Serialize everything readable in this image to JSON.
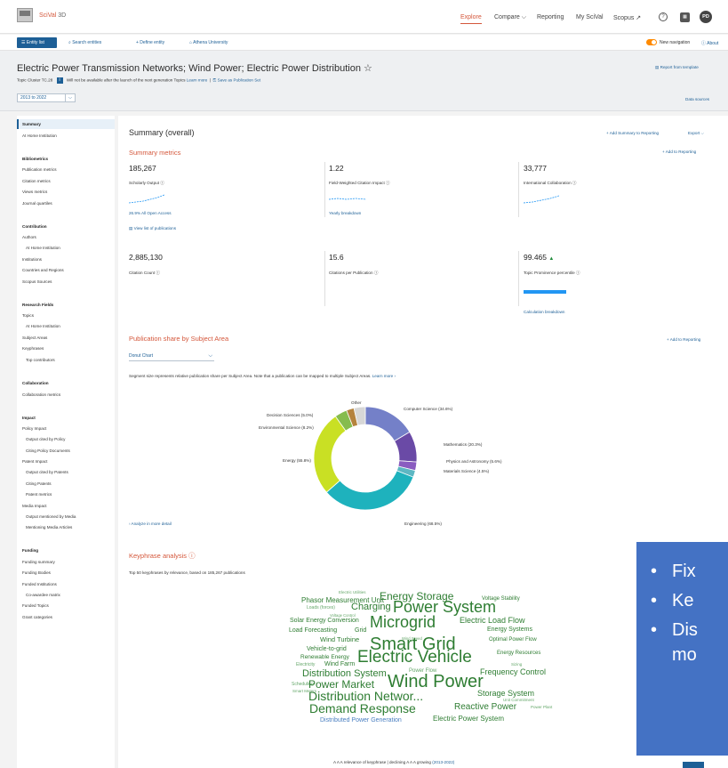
{
  "topbar": {
    "app_name": "SciVal",
    "app_suffix": "3D",
    "nav": [
      "Explore",
      "Compare ⌵",
      "Reporting",
      "My SciVal",
      "Scopus ↗"
    ],
    "help_icon": "?",
    "grid_icon": "▦",
    "avatar": "PD"
  },
  "toolbar": {
    "entity_list": "Entity list",
    "search": "Search entities",
    "define_entity": "+ Define entity",
    "institution": "Athena University",
    "new_navigation": "New navigation",
    "about": "About"
  },
  "title_band": {
    "title": "Electric Power Transmission Networks; Wind Power; Electric Power Distribution",
    "star": "☆",
    "topic_cluster": "Topic Cluster TC.28",
    "notice": "Will not be available after the launch of the next generation Topics",
    "learn_more": "Learn more",
    "save_as": "Save as Publication Set",
    "report": "Report from template",
    "year_range": "2013 to 2022",
    "data_sources": "Data sources"
  },
  "sidebar": {
    "items": [
      {
        "label": "Summary",
        "type": "selected"
      },
      {
        "label": "At Home Institution",
        "type": "item"
      },
      {
        "label": "Bibliometrics",
        "type": "head"
      },
      {
        "label": "Publication metrics",
        "type": "item"
      },
      {
        "label": "Citation metrics",
        "type": "item"
      },
      {
        "label": "Views metrics",
        "type": "item"
      },
      {
        "label": "Journal quartiles",
        "type": "item"
      },
      {
        "label": "Contribution",
        "type": "head"
      },
      {
        "label": "Authors",
        "type": "item"
      },
      {
        "label": "At Home Institution",
        "type": "indent"
      },
      {
        "label": "Institutions",
        "type": "item"
      },
      {
        "label": "Countries and Regions",
        "type": "item"
      },
      {
        "label": "Scopus Sources",
        "type": "item"
      },
      {
        "label": "Research Fields",
        "type": "head"
      },
      {
        "label": "Topics",
        "type": "item"
      },
      {
        "label": "At Home Institution",
        "type": "indent"
      },
      {
        "label": "Subject Areas",
        "type": "item"
      },
      {
        "label": "Keyphrases",
        "type": "item"
      },
      {
        "label": "Top contributors",
        "type": "indent"
      },
      {
        "label": "Collaboration",
        "type": "head"
      },
      {
        "label": "Collaboration metrics",
        "type": "item"
      },
      {
        "label": "Impact",
        "type": "head"
      },
      {
        "label": "Policy Impact",
        "type": "item"
      },
      {
        "label": "Output cited by Policy",
        "type": "indent"
      },
      {
        "label": "Citing Policy Documents",
        "type": "indent"
      },
      {
        "label": "Patent Impact",
        "type": "item"
      },
      {
        "label": "Output cited by Patents",
        "type": "indent"
      },
      {
        "label": "Citing Patents",
        "type": "indent"
      },
      {
        "label": "Patent metrics",
        "type": "indent"
      },
      {
        "label": "Media Impact",
        "type": "item"
      },
      {
        "label": "Output mentioned by Media",
        "type": "indent"
      },
      {
        "label": "Mentioning Media Articles",
        "type": "indent"
      },
      {
        "label": "Funding",
        "type": "head"
      },
      {
        "label": "Funding summary",
        "type": "item"
      },
      {
        "label": "Funding Bodies",
        "type": "item"
      },
      {
        "label": "Funded Institutions",
        "type": "item"
      },
      {
        "label": "Co-awardee matrix",
        "type": "indent"
      },
      {
        "label": "Funded Topics",
        "type": "item"
      },
      {
        "label": "Grant categories",
        "type": "item"
      }
    ]
  },
  "summary": {
    "title": "Summary (overall)",
    "add_summary": "+ Add Summary to Reporting",
    "export": "Export ⌵",
    "metrics_title": "Summary metrics",
    "add_to_reporting": "+ Add to Reporting",
    "metrics": [
      {
        "value": "185,267",
        "label": "Scholarly Output ⓘ",
        "link": "26.9% All Open Access"
      },
      {
        "value": "1.22",
        "label": "Field-Weighted Citation Impact ⓘ",
        "link": "Yearly breakdown"
      },
      {
        "value": "33,777",
        "label": "International Collaboration ⓘ",
        "link": ""
      },
      {
        "value": "2,885,130",
        "label": "Citation Count ⓘ",
        "link": ""
      },
      {
        "value": "15.6",
        "label": "Citations per Publication ⓘ",
        "link": ""
      },
      {
        "value": "99.465",
        "label": "Topic Prominence percentile ⓘ",
        "link": "Calculation breakdown",
        "percentile": 0.99465
      }
    ],
    "view_list": "View list of publications",
    "up_arrow": "▲"
  },
  "subject_area": {
    "title": "Publication share by Subject Area",
    "add_to_reporting": "+ Add to Reporting",
    "chart_type": "Donut Chart",
    "note": "Segment size represents relative publication share per Subject Area. Note that a publication can be mapped to multiple Subject Areas.",
    "learn_more": "Learn more ›",
    "analyze": "›  Analyze in more detail"
  },
  "chart_data": {
    "type": "pie",
    "variant": "donut",
    "slices": [
      {
        "label": "Computer Science (34.6%)",
        "value": 34.6,
        "color": "#7480c8"
      },
      {
        "label": "Mathematics (20.3%)",
        "value": 20.3,
        "color": "#6a4aa6"
      },
      {
        "label": "Physics and Astronomy (5.6%)",
        "value": 5.6,
        "color": "#8a5cc0"
      },
      {
        "label": "Materials Science (4.5%)",
        "value": 4.5,
        "color": "#5db7c3"
      },
      {
        "label": "Engineering (68.5%)",
        "value": 68.5,
        "color": "#1eb2bd"
      },
      {
        "label": "Energy (55.8%)",
        "value": 55.8,
        "color": "#c9e024"
      },
      {
        "label": "Environmental Science (8.2%)",
        "value": 8.2,
        "color": "#86bc4e"
      },
      {
        "label": "Decision Sciences (5.0%)",
        "value": 5.0,
        "color": "#b5833e"
      },
      {
        "label": "Other",
        "value": 7.5,
        "color": "#d7d7d7"
      }
    ]
  },
  "keyphrase": {
    "title": "Keyphrase analysis ⓘ",
    "subtitle": "Top 50 keyphrases by relevance, based on 185,267 publications",
    "legend": "A A A  relevance of keyphrase  |  declining A A A growing",
    "legend_years": "(2013-2022)",
    "words": [
      {
        "t": "Electric Utilities",
        "c": "light"
      },
      {
        "t": "Phasor Measurement Unit",
        "c": "g"
      },
      {
        "t": "Energy Storage",
        "c": "g"
      },
      {
        "t": "Voltage Stability",
        "c": "g"
      },
      {
        "t": "Loads (forces)",
        "c": "light"
      },
      {
        "t": "Charging",
        "c": "g"
      },
      {
        "t": "Power System",
        "c": "g"
      },
      {
        "t": "Voltage Control",
        "c": "light"
      },
      {
        "t": "Solar Energy Conversion",
        "c": "g"
      },
      {
        "t": "Microgrid",
        "c": "g"
      },
      {
        "t": "Electric Load Flow",
        "c": "g"
      },
      {
        "t": "Load Forecasting",
        "c": "g"
      },
      {
        "t": "Grid",
        "c": "g"
      },
      {
        "t": "Energy Systems",
        "c": "g"
      },
      {
        "t": "Wind Speed",
        "c": "light"
      },
      {
        "t": "Wind Turbine",
        "c": "g"
      },
      {
        "t": "Smart Grid",
        "c": "g"
      },
      {
        "t": "Optimal Power Flow",
        "c": "g"
      },
      {
        "t": "Vehicle-to-grid",
        "c": "g"
      },
      {
        "t": "Renewable Energy",
        "c": "g"
      },
      {
        "t": "Electric Vehicle",
        "c": "g"
      },
      {
        "t": "Energy Resources",
        "c": "g"
      },
      {
        "t": "Electricity",
        "c": "light"
      },
      {
        "t": "Wind Farm",
        "c": "g"
      },
      {
        "t": "Sizing",
        "c": "light"
      },
      {
        "t": "Distribution System",
        "c": "g"
      },
      {
        "t": "Power Flow",
        "c": "light"
      },
      {
        "t": "Frequency Control",
        "c": "g"
      },
      {
        "t": "Scheduling",
        "c": "light"
      },
      {
        "t": "Power Market",
        "c": "g"
      },
      {
        "t": "Wind Power",
        "c": "g"
      },
      {
        "t": "Smart Meters",
        "c": "light"
      },
      {
        "t": "Distribution Networ...",
        "c": "g"
      },
      {
        "t": "Storage System",
        "c": "g"
      },
      {
        "t": "Unit Commitment",
        "c": "light"
      },
      {
        "t": "Demand Response",
        "c": "g"
      },
      {
        "t": "Reactive Power",
        "c": "g"
      },
      {
        "t": "Power Plant",
        "c": "light"
      },
      {
        "t": "Distributed Power Generation",
        "c": "blue"
      },
      {
        "t": "Electric Power System",
        "c": "g"
      }
    ]
  },
  "overlay": {
    "bullets": [
      "Fix",
      "Ke",
      "Dis",
      "mo"
    ]
  }
}
